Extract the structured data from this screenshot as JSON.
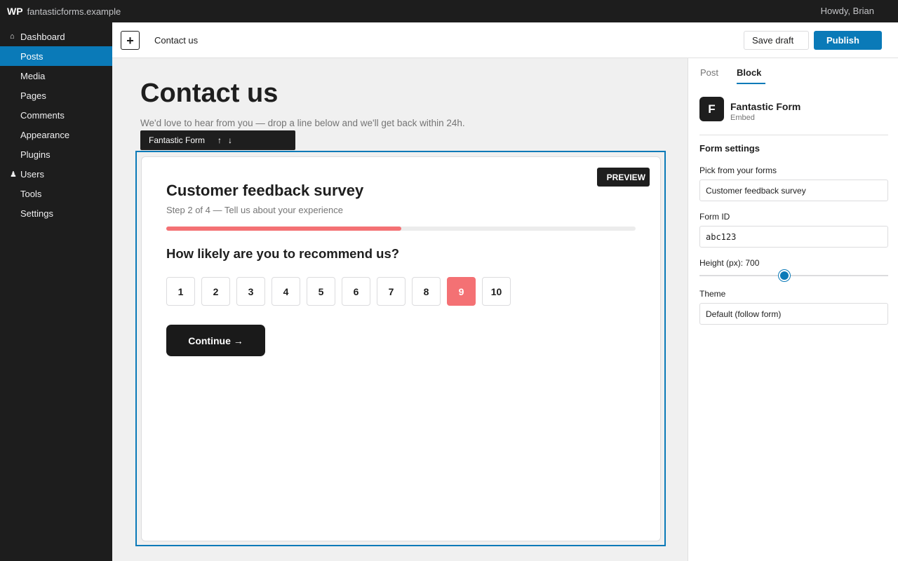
{
  "adminbar": {
    "logo": "WP",
    "site_name": "fantasticforms.example",
    "howdy": "Howdy, Brian"
  },
  "menu": {
    "items": [
      {
        "label": "Dashboard",
        "icon": "home-icon",
        "glyph": "⌂"
      },
      {
        "label": "Posts",
        "icon": "pin-icon",
        "glyph": ""
      },
      {
        "label": "Media",
        "icon": "media-icon",
        "glyph": ""
      },
      {
        "label": "Pages",
        "icon": "page-icon",
        "glyph": ""
      },
      {
        "label": "Comments",
        "icon": "comment-icon",
        "glyph": ""
      },
      {
        "label": "Appearance",
        "icon": "brush-icon",
        "glyph": ""
      },
      {
        "label": "Plugins",
        "icon": "plugin-icon",
        "glyph": ""
      },
      {
        "label": "Users",
        "icon": "user-icon",
        "glyph": "♟"
      },
      {
        "label": "Tools",
        "icon": "wrench-icon",
        "glyph": ""
      },
      {
        "label": "Settings",
        "icon": "settings-icon",
        "glyph": ""
      }
    ],
    "active_index": 1
  },
  "header": {
    "inserter": "+",
    "doc_title": "Contact us",
    "save_draft": "Save draft",
    "publish": "Publish"
  },
  "canvas": {
    "title": "Contact us",
    "intro": "We'd love to hear from you — drop a line below and we'll get back within 24h.",
    "toolbar": {
      "block_name": "Fantastic Form",
      "move_up": "↑",
      "move_down": "↓",
      "glyph_a": "",
      "glyph_b": "",
      "glyph_c": ""
    }
  },
  "form": {
    "preview_badge": "PREVIEW",
    "title": "Customer feedback survey",
    "step": "Step 2 of 4 — Tell us about your experience",
    "progress": 0.5,
    "question": "How likely are you to recommend us?",
    "scale": [
      "1",
      "2",
      "3",
      "4",
      "5",
      "6",
      "7",
      "8",
      "9",
      "10"
    ],
    "selected": "9",
    "continue": "Continue →"
  },
  "settings": {
    "tabs": {
      "post": "Post",
      "block": "Block"
    },
    "block_card": {
      "icon_letter": "F",
      "title": "Fantastic Form",
      "subtitle": "Embed"
    },
    "panel_title": "Form settings",
    "panel_toggle_glyph": "",
    "pick_label": "Pick from your forms",
    "pick_value": "Customer feedback survey",
    "select_caret_glyph": "",
    "form_id_label": "Form ID",
    "form_id_value": "abc123",
    "height_label": "Height (px): 700",
    "height_fraction": 0.45,
    "theme_label": "Theme",
    "theme_value": "Default (follow form)"
  },
  "colors": {
    "accent": "#0a7ab8",
    "form_accent": "#f47174",
    "dark": "#1d1d1d"
  }
}
